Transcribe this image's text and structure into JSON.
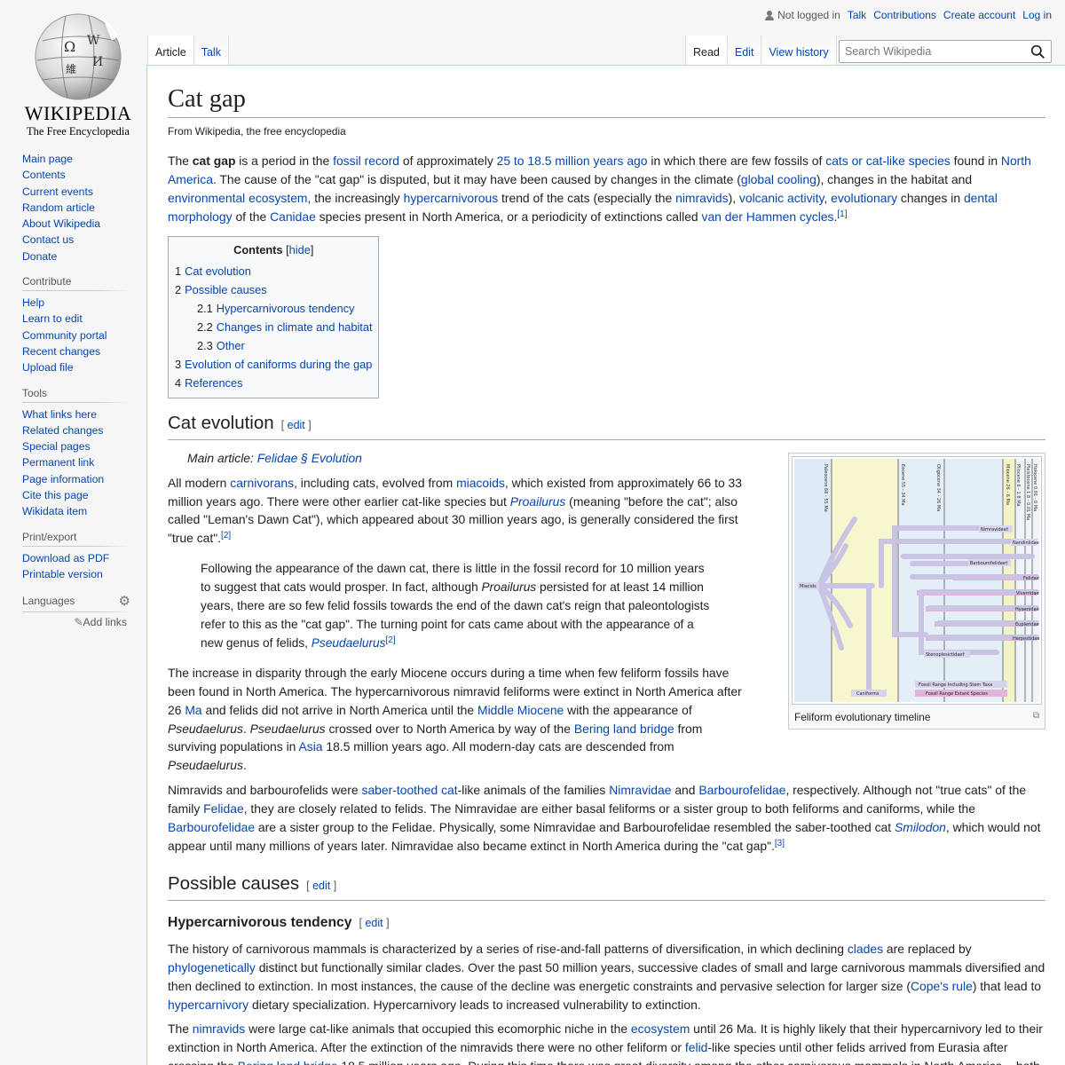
{
  "logo": {
    "wordmark": "WIKIPEDIA",
    "tagline": "The Free Encyclopedia"
  },
  "personal": {
    "not_logged_in": "Not logged in",
    "talk": "Talk",
    "contributions": "Contributions",
    "create_account": "Create account",
    "log_in": "Log in"
  },
  "tabs": {
    "article": "Article",
    "talk": "Talk",
    "read": "Read",
    "edit": "Edit",
    "view_history": "View history"
  },
  "search": {
    "placeholder": "Search Wikipedia"
  },
  "sidebar": {
    "navigation": [
      "Main page",
      "Contents",
      "Current events",
      "Random article",
      "About Wikipedia",
      "Contact us",
      "Donate"
    ],
    "contribute_heading": "Contribute",
    "contribute": [
      "Help",
      "Learn to edit",
      "Community portal",
      "Recent changes",
      "Upload file"
    ],
    "tools_heading": "Tools",
    "tools": [
      "What links here",
      "Related changes",
      "Special pages",
      "Permanent link",
      "Page information",
      "Cite this page",
      "Wikidata item"
    ],
    "print_heading": "Print/export",
    "print": [
      "Download as PDF",
      "Printable version"
    ],
    "languages_heading": "Languages",
    "add_links": "Add links"
  },
  "article": {
    "title": "Cat gap",
    "tagline": "From Wikipedia, the free encyclopedia",
    "edit_label": "edit",
    "toc": {
      "title": "Contents",
      "toggle": "hide",
      "items": [
        {
          "num": "1",
          "label": "Cat evolution",
          "level": 1
        },
        {
          "num": "2",
          "label": "Possible causes",
          "level": 1
        },
        {
          "num": "2.1",
          "label": "Hypercarnivorous tendency",
          "level": 2
        },
        {
          "num": "2.2",
          "label": "Changes in climate and habitat",
          "level": 2
        },
        {
          "num": "2.3",
          "label": "Other",
          "level": 2
        },
        {
          "num": "3",
          "label": "Evolution of caniforms during the gap",
          "level": 1
        },
        {
          "num": "4",
          "label": "References",
          "level": 1
        }
      ]
    },
    "sections": {
      "cat_evolution": "Cat evolution",
      "main_article_prefix": "Main article: ",
      "main_article_link": "Felidae § Evolution",
      "possible_causes": "Possible causes",
      "hypercarnivorous": "Hypercarnivorous tendency"
    },
    "figure": {
      "caption": "Feliform evolutionary timeline",
      "epochs": [
        "Paleocene 66 - 55 Ma",
        "Eocene 55 - 34 Ma",
        "Oligocene 34 - 26 Ma",
        "Miocene 26 - 6 Ma",
        "Pliocene 6 - 1.8 Ma",
        "Pleistocene 1.8 - 0.01 Ma",
        "Holocene 0.01 - 0 Ma"
      ],
      "taxa": [
        "Miacids",
        "Nimravidae†",
        "Nandiniidae",
        "Barbourofelidae†",
        "Felidae",
        "Viverridae",
        "Hyaenidae",
        "Eupleridae",
        "Herpestidae",
        "Stenoplesictidae†",
        "Caniforms"
      ],
      "legend": [
        "Fossil Range Including Stem Taxa",
        "Fossil Range Extant Species"
      ]
    }
  }
}
